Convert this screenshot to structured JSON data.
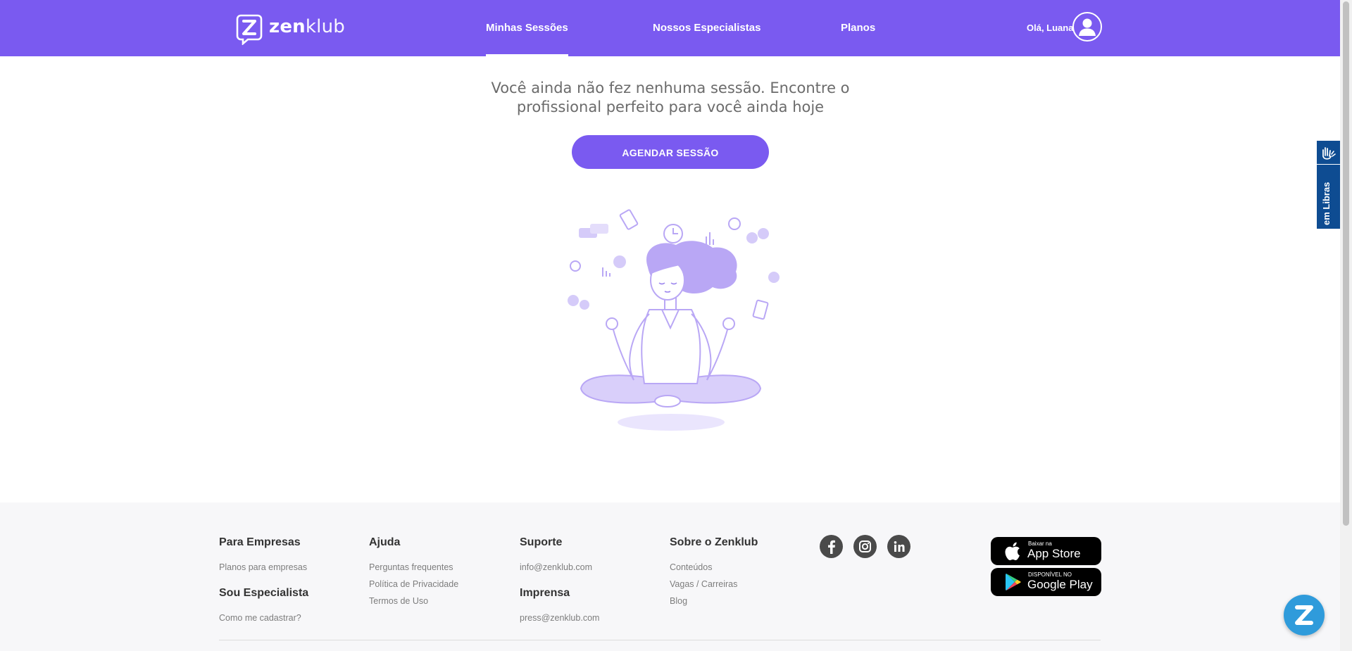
{
  "header": {
    "brand": "zenklub",
    "nav": [
      {
        "label": "Minhas Sessões",
        "active": true
      },
      {
        "label": "Nossos Especialistas",
        "active": false
      },
      {
        "label": "Planos",
        "active": false
      }
    ],
    "greeting": "Olá, Luana"
  },
  "main": {
    "empty_message": "Você ainda não fez nenhuma sessão. Encontre o profissional perfeito para você ainda hoje",
    "cta_label": "AGENDAR SESSÃO"
  },
  "libras_widget": {
    "label": "em Libras"
  },
  "footer": {
    "columns": {
      "empresas": {
        "title": "Para Empresas",
        "links": [
          "Planos para empresas"
        ]
      },
      "especialista": {
        "title": "Sou Especialista",
        "links": [
          "Como me cadastrar?"
        ]
      },
      "ajuda": {
        "title": "Ajuda",
        "links": [
          "Perguntas frequentes",
          "Política de Privacidade",
          "Termos de Uso"
        ]
      },
      "suporte": {
        "title": "Suporte",
        "links": [
          "info@zenklub.com"
        ]
      },
      "imprensa": {
        "title": "Imprensa",
        "links": [
          "press@zenklub.com"
        ]
      },
      "sobre": {
        "title": "Sobre o Zenklub",
        "links": [
          "Conteúdos",
          "Vagas / Carreiras",
          "Blog"
        ]
      }
    },
    "social": [
      "facebook-icon",
      "instagram-icon",
      "linkedin-icon"
    ],
    "stores": {
      "app_store": {
        "small": "Baixar na",
        "big": "App Store"
      },
      "google_play": {
        "small": "DISPONÍVEL NO",
        "big": "Google Play"
      }
    }
  },
  "colors": {
    "brand_purple": "#7A5AF0",
    "illustration_purple": "#B9A7F5",
    "footer_bg": "#F7F7F9",
    "libras_blue": "#0E4C92",
    "chat_blue": "#2F9BDB"
  }
}
